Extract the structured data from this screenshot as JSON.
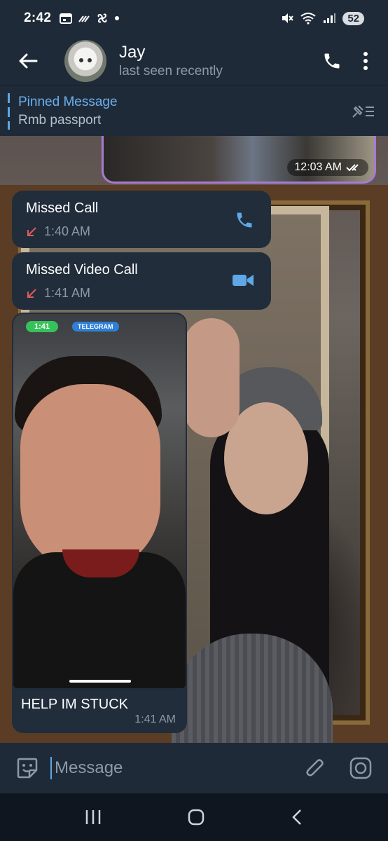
{
  "status_bar": {
    "time": "2:42",
    "battery": "52"
  },
  "header": {
    "name": "Jay",
    "status": "last seen recently"
  },
  "pinned": {
    "title": "Pinned Message",
    "text": "Rmb passport"
  },
  "photo_message": {
    "time": "12:03 AM"
  },
  "calls": [
    {
      "title": "Missed Call",
      "time": "1:40 AM",
      "type": "voice"
    },
    {
      "title": "Missed Video Call",
      "time": "1:41 AM",
      "type": "video"
    }
  ],
  "video_message": {
    "screen_time": "1:41",
    "screen_badge": "TELEGRAM",
    "caption": "HELP IM STUCK",
    "time": "1:41 AM"
  },
  "composer": {
    "placeholder": "Message"
  },
  "colors": {
    "accent": "#6bb1ee",
    "missed": "#e05a5a",
    "bubble": "#212d3b",
    "header": "#1f2a38"
  }
}
